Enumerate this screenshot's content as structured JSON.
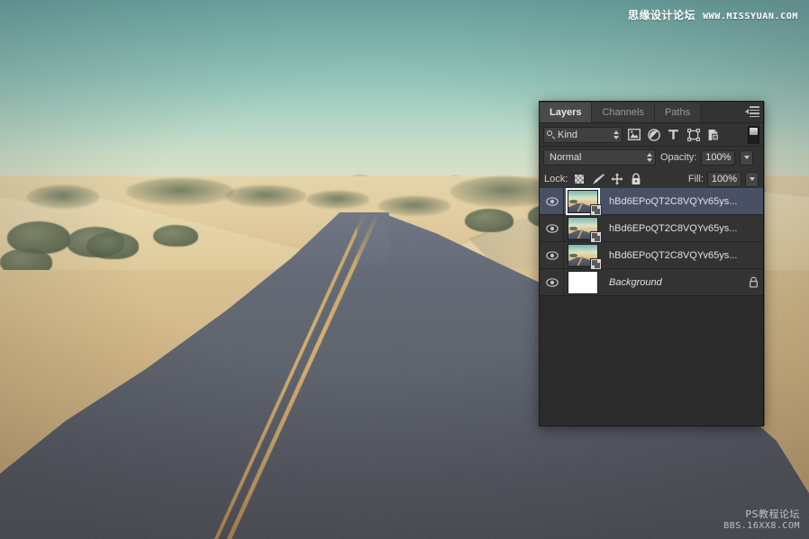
{
  "watermarks": {
    "top_cn": "思缘设计论坛",
    "top_en": "WWW.MISSYUAN.COM",
    "bottom_cn": "PS教程论坛",
    "bottom_en": "BBS.16XX8.COM"
  },
  "photo": {
    "description": "Desert road photograph with sand dunes, teal sky and yellow double centerline",
    "sky_color": "#8abdb4",
    "sand_color": "#e2cb9a",
    "road_color": "#5b6270",
    "line_color": "#c9a368"
  },
  "panel": {
    "tabs": [
      {
        "label": "Layers",
        "active": true
      },
      {
        "label": "Channels",
        "active": false
      },
      {
        "label": "Paths",
        "active": false
      }
    ],
    "menu_icon": "panel-menu-icon",
    "filter": {
      "kind_label": "Kind",
      "search_icon": "search-icon",
      "stepper_icon": "stepper-icon",
      "icons": [
        {
          "name": "filter-pixel-icon",
          "title": "Pixel layers"
        },
        {
          "name": "filter-adjustment-icon",
          "title": "Adjustment layers"
        },
        {
          "name": "filter-type-icon",
          "title": "Type layers",
          "glyph": "T"
        },
        {
          "name": "filter-shape-icon",
          "title": "Shape layers"
        },
        {
          "name": "filter-smartobject-icon",
          "title": "Smart objects"
        }
      ],
      "toggle_name": "filter-enable-toggle"
    },
    "blend": {
      "mode": "Normal",
      "opacity_label": "Opacity:",
      "opacity_value": "100%",
      "fill_label": "Fill:",
      "fill_value": "100%"
    },
    "lock": {
      "label": "Lock:",
      "items": [
        {
          "name": "lock-transparent-pixels-icon",
          "title": "Lock transparent pixels"
        },
        {
          "name": "lock-image-pixels-icon",
          "title": "Lock image pixels"
        },
        {
          "name": "lock-position-icon",
          "title": "Lock position"
        },
        {
          "name": "lock-all-icon",
          "title": "Lock all"
        }
      ]
    },
    "layers": [
      {
        "name": "hBd6EPoQT2C8VQYv65ys...",
        "visible": true,
        "selected": true,
        "thumb": "photo",
        "smart_object": true,
        "locked": false,
        "italic": false
      },
      {
        "name": "hBd6EPoQT2C8VQYv65ys...",
        "visible": true,
        "selected": false,
        "thumb": "photo",
        "smart_object": true,
        "locked": false,
        "italic": false
      },
      {
        "name": "hBd6EPoQT2C8VQYv65ys...",
        "visible": true,
        "selected": false,
        "thumb": "photo",
        "smart_object": true,
        "locked": false,
        "italic": false
      },
      {
        "name": "Background",
        "visible": true,
        "selected": false,
        "thumb": "white",
        "smart_object": false,
        "locked": true,
        "italic": true
      }
    ]
  }
}
